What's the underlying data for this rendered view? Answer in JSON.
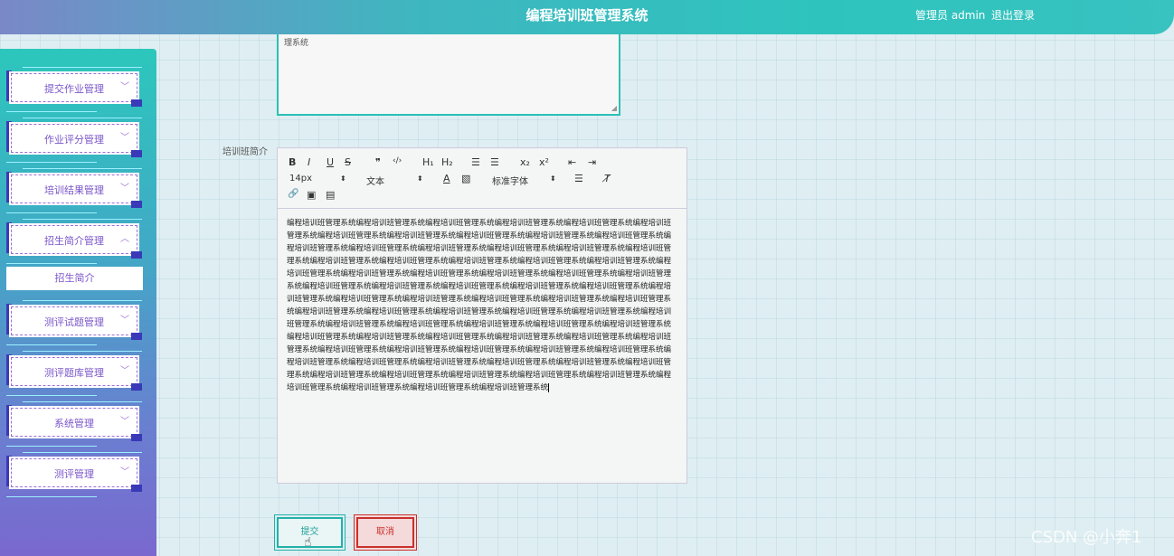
{
  "header": {
    "title": "编程培训班管理系统",
    "user_label": "管理员 admin",
    "logout_label": "退出登录"
  },
  "sidebar": {
    "items": [
      {
        "label": "提交作业管理",
        "chevron": "﹀"
      },
      {
        "label": "作业评分管理",
        "chevron": "﹀"
      },
      {
        "label": "培训结果管理",
        "chevron": "﹀"
      },
      {
        "label": "招生简介管理",
        "chevron": "︿"
      },
      {
        "label": "测评试题管理",
        "chevron": "﹀"
      },
      {
        "label": "测评题库管理",
        "chevron": "﹀"
      },
      {
        "label": "系统管理",
        "chevron": "﹀"
      },
      {
        "label": "测评管理",
        "chevron": "﹀"
      }
    ],
    "submenu_label": "招生简介"
  },
  "form": {
    "prev_textarea_value": "理系统",
    "intro_label": "培训班简介",
    "toolbar": {
      "bold": "B",
      "italic": "I",
      "underline": "U",
      "strike": "S",
      "quote": "❞",
      "code": "‹/›",
      "h1": "H₁",
      "h2": "H₂",
      "ordered_list": "☰",
      "bullet_list": "☰",
      "subscript": "x₂",
      "superscript": "x²",
      "outdent": "⇤",
      "indent": "⇥",
      "font_size": "14px",
      "text_style": "文本",
      "font_family": "标准字体",
      "color": "A",
      "background": "▧",
      "align": "☰",
      "clean": "T̸",
      "link": "🔗",
      "image": "▣",
      "video": "▤"
    },
    "content": "编程培训班管理系统编程培训班管理系统编程培训班管理系统编程培训班管理系统编程培训班管理系统编程培训班管理系统编程培训班管理系统编程培训班管理系统编程培训班管理系统编程培训班管理系统编程培训班管理系统编程培训班管理系统编程培训班管理系统编程培训班管理系统编程培训班管理系统编程培训班管理系统编程培训班管理系统编程培训班管理系统编程培训班管理系统编程培训班管理系统编程培训班管理系统编程培训班管理系统编程培训班管理系统编程培训班管理系统编程培训班管理系统编程培训班管理系统编程培训班管理系统编程培训班管理系统编程培训班管理系统编程培训班管理系统编程培训班管理系统编程培训班管理系统编程培训班管理系统编程培训班管理系统编程培训班管理系统编程培训班管理系统编程培训班管理系统编程培训班管理系统编程培训班管理系统编程培训班管理系统编程培训班管理系统编程培训班管理系统编程培训班管理系统编程培训班管理系统编程培训班管理系统编程培训班管理系统编程培训班管理系统编程培训班管理系统编程培训班管理系统编程培训班管理系统编程培训班管理系统编程培训班管理系统编程培训班管理系统编程培训班管理系统编程培训班管理系统编程培训班管理系统编程培训班管理系统编程培训班管理系统编程培训班管理系统编程培训班管理系统编程培训班管理系统编程培训班管理系统编程培训班管理系统编程培训班管理系统编程培训班管理系统编程培训班管理系统编程培训班管理系统编程培训班管理系统编程培训班管理系统编程培训班管理系统编程培训班管理系统编程培训班管理系统编程培训班管理系统编程培训班管理系统编程培训班管理系统编程培训班管理系统",
    "submit_label": "提交",
    "cancel_label": "取消"
  },
  "watermark": "CSDN @小奔1"
}
